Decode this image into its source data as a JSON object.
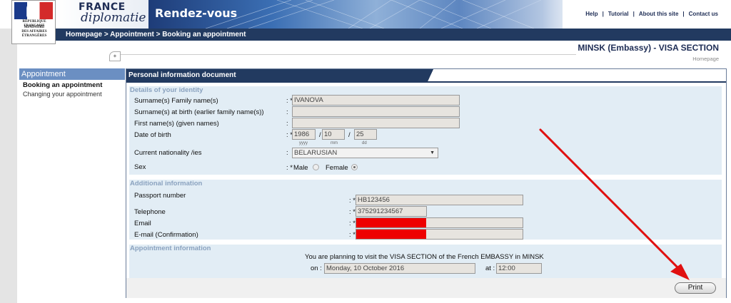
{
  "header": {
    "logo": {
      "republic_text": "RÉPUBLIQUE FRANÇAISE",
      "ministry_lines": [
        "MINISTÈRE",
        "DES AFFAIRES",
        "ÉTRANGÈRES"
      ]
    },
    "brand_france": "FRANCE",
    "brand_diplomatie": "diplomatie",
    "title": "Rendez-vous",
    "links": [
      "Help",
      "Tutorial",
      "About this site",
      "Contact us"
    ],
    "breadcrumb": "Homepage > Appointment > Booking an appointment",
    "section_title": "MINSK (Embassy) - VISA SECTION",
    "homepage_link": "Homepage",
    "plus_tab": "+"
  },
  "menu": {
    "heading": "Appointment",
    "items": [
      "Booking an appointment",
      "Changing your appointment"
    ]
  },
  "form": {
    "panel_title": "Personal information document",
    "identity": {
      "heading": "Details of your identity",
      "surname_label": "Surname(s) Family name(s)",
      "surname_value": "IVANOVA",
      "birth_surname_label": "Surname(s) at birth (earlier family name(s))",
      "birth_surname_value": "",
      "first_name_label": "First name(s) (given names)",
      "first_name_value": "",
      "dob_label": "Date of birth",
      "dob_year": "1986",
      "dob_month": "10",
      "dob_day": "25",
      "dob_hint_year": "yyyy",
      "dob_hint_month": "mm",
      "dob_hint_day": "dd",
      "nationality_label": "Current nationality /ies",
      "nationality_value": "BELARUSIAN",
      "sex_label": "Sex",
      "sex_male": "Male",
      "sex_female": "Female",
      "sex_selected": "Female"
    },
    "additional": {
      "heading": "Additional information",
      "passport_label": "Passport number",
      "passport_value": "HB123456",
      "telephone_label": "Telephone",
      "telephone_value": "375291234567",
      "email_label": "Email",
      "email_confirm_label": "E-mail (Confirmation)"
    },
    "appointment": {
      "heading": "Appointment information",
      "sentence": "You are planning to visit the VISA SECTION of the French EMBASSY in MINSK",
      "on_label": "on :",
      "date_value": "Monday, 10 October 2016",
      "at_label": "at :",
      "time_value": "12:00"
    },
    "colon": ":",
    "colon_required": ": *",
    "slash": "/",
    "print_label": "Print"
  },
  "colors": {
    "navy": "#223a60",
    "menu_blue": "#6b8fc2",
    "section_bg": "#e2edf5",
    "redaction": "#ee0000",
    "annotation_arrow": "#e01010"
  }
}
